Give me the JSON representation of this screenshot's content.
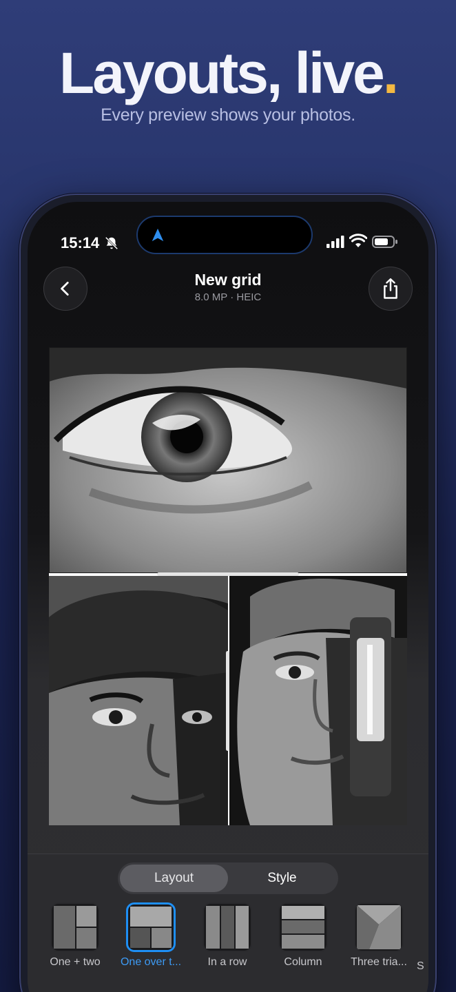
{
  "hero": {
    "title": "Layouts, live",
    "title_dot": ".",
    "subtitle": "Every preview shows your photos."
  },
  "status_bar": {
    "time": "15:14",
    "icons": [
      "bell-slash-icon",
      "location-arrow-icon",
      "cellular-signal-icon",
      "wifi-icon",
      "battery-icon"
    ]
  },
  "nav": {
    "back_icon": "chevron-left-icon",
    "title": "New grid",
    "subtitle": "8.0 MP · HEIC",
    "share_icon": "share-icon"
  },
  "canvas": {
    "photos": [
      "eye-close-up",
      "face-with-cap-left",
      "face-with-lantern-right"
    ],
    "fab_icon": "resize-vertical-icon"
  },
  "segment": {
    "items": [
      "Layout",
      "Style"
    ],
    "selected": "Layout"
  },
  "layouts": [
    {
      "label": "One + two",
      "selected": false
    },
    {
      "label": "One over t...",
      "selected": true
    },
    {
      "label": "In a row",
      "selected": false
    },
    {
      "label": "Column",
      "selected": false
    },
    {
      "label": "Three tria...",
      "selected": false
    },
    {
      "label": "S",
      "selected": false
    }
  ],
  "colors": {
    "accent": "#1e8ff5",
    "hero_dot": "#f4b942",
    "background_top": "#2f3d78",
    "background_bottom": "#151c43"
  }
}
